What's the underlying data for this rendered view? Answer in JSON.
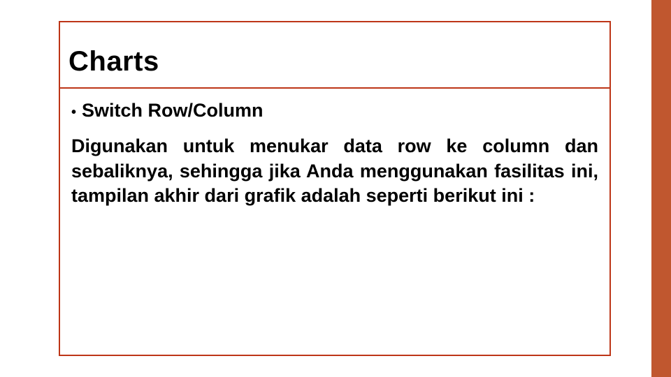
{
  "slide": {
    "title": "Charts",
    "bullet": {
      "glyph": "•",
      "text": "Switch Row/Column"
    },
    "paragraph": "Digunakan untuk menukar data row ke column dan sebaliknya, sehingga jika Anda menggunakan fasilitas ini, tampilan akhir dari grafik adalah seperti berikut ini :"
  },
  "colors": {
    "accent": "#c0572f",
    "border": "#bd3517"
  }
}
